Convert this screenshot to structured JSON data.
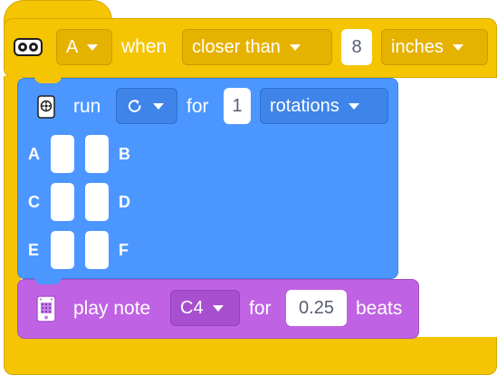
{
  "event_block": {
    "port": "A",
    "when_label": "when",
    "condition": "closer than",
    "distance": "8",
    "unit": "inches",
    "sensor_icon": "distance-sensor-icon"
  },
  "motor_block": {
    "run_label": "run",
    "direction_icon": "clockwise-arrow-icon",
    "for_label": "for",
    "amount": "1",
    "unit": "rotations",
    "ports": [
      "A",
      "B",
      "C",
      "D",
      "E",
      "F"
    ],
    "motor_icon": "motor-icon"
  },
  "sound_block": {
    "play_note_label": "play note",
    "note": "C4",
    "for_label": "for",
    "beats_value": "0.25",
    "beats_label": "beats",
    "hub_icon": "hub-icon"
  },
  "colors": {
    "event": "#f5c402",
    "motor": "#4c97ff",
    "sound": "#bf62e3"
  }
}
